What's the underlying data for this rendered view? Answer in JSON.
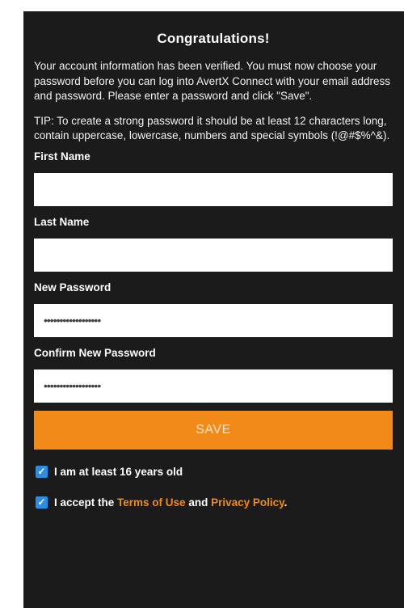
{
  "header": {
    "title": "Congratulations!"
  },
  "intro": {
    "message": "Your account information has been verified. You must now choose your password before you can log into AvertX Connect with your email address and password. Please enter a password and click \"Save\".",
    "tip": "TIP: To create a strong password it should be at least 12 characters long, contain uppercase, lowercase, numbers and special symbols (!@#$%^&)."
  },
  "form": {
    "first_name": {
      "label": "First Name",
      "value": ""
    },
    "last_name": {
      "label": "Last Name",
      "value": ""
    },
    "new_password": {
      "label": "New Password",
      "masked_value": "••••••••••••••••••"
    },
    "confirm_password": {
      "label": "Confirm New Password",
      "masked_value": "••••••••••••••••••"
    },
    "save_label": "SAVE"
  },
  "checkboxes": {
    "age": {
      "label": "I am at least 16 years old",
      "checked": true
    },
    "terms": {
      "prefix": "I accept the ",
      "terms_link": "Terms of Use",
      "middle": " and ",
      "privacy_link": "Privacy Policy",
      "suffix": ".",
      "checked": true
    }
  },
  "colors": {
    "panel_bg": "#1b1b1b",
    "accent": "#f28a1a",
    "checkbox": "#2e8de0"
  },
  "icons": {
    "checkbox": "check-icon"
  }
}
